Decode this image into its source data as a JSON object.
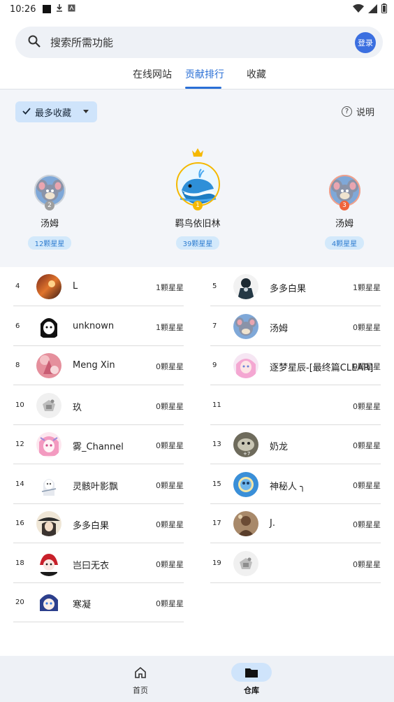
{
  "status": {
    "time": "10:26"
  },
  "search": {
    "placeholder": "搜索所需功能",
    "login": "登录"
  },
  "tabs": [
    {
      "label": "在线网站"
    },
    {
      "label": "贡献排行"
    },
    {
      "label": "收藏"
    }
  ],
  "filter": {
    "label": "最多收藏",
    "help": "说明"
  },
  "top3": [
    {
      "rank": "1",
      "name": "羁鸟依旧林",
      "stars": "39颗星星"
    },
    {
      "rank": "2",
      "name": "汤姆",
      "stars": "12颗星星"
    },
    {
      "rank": "3",
      "name": "汤姆",
      "stars": "4颗星星"
    }
  ],
  "rows": [
    {
      "rank": "4",
      "name": "L",
      "stars": "1颗星星",
      "avatar": "sunset"
    },
    {
      "rank": "5",
      "name": "多多白果",
      "stars": "1颗星星",
      "avatar": "dark-figure"
    },
    {
      "rank": "6",
      "name": "unknown",
      "stars": "1颗星星",
      "avatar": "anime-bw"
    },
    {
      "rank": "7",
      "name": "汤姆",
      "stars": "0颗星星",
      "avatar": "tom"
    },
    {
      "rank": "8",
      "name": "Meng Xin",
      "stars": "0颗星星",
      "avatar": "pink-fox"
    },
    {
      "rank": "9",
      "name": "逐梦星辰-[最终篇CLEAR]",
      "stars": "0颗星星",
      "avatar": "pink-girl"
    },
    {
      "rank": "10",
      "name": "玖",
      "stars": "0颗星星",
      "avatar": "default"
    },
    {
      "rank": "11",
      "name": "",
      "stars": "0颗星星",
      "avatar": "none"
    },
    {
      "rank": "12",
      "name": "雾_Channel",
      "stars": "0颗星星",
      "avatar": "pink-anime"
    },
    {
      "rank": "13",
      "name": "奶龙",
      "stars": "0颗星星",
      "avatar": "gray-photo"
    },
    {
      "rank": "14",
      "name": "灵骸叶影飘",
      "stars": "0颗星星",
      "avatar": "white-anime"
    },
    {
      "rank": "15",
      "name": "神秘人 ╮",
      "stars": "0颗星星",
      "avatar": "blue-planet"
    },
    {
      "rank": "16",
      "name": "多多白果",
      "stars": "0颗星星",
      "avatar": "hat-girl"
    },
    {
      "rank": "17",
      "name": "J.",
      "stars": "0颗星星",
      "avatar": "brown-photo"
    },
    {
      "rank": "18",
      "name": "岂曰无衣",
      "stars": "0颗星星",
      "avatar": "red-anime"
    },
    {
      "rank": "19",
      "name": "",
      "stars": "0颗星星",
      "avatar": "default"
    },
    {
      "rank": "20",
      "name": "寒凝",
      "stars": "0颗星星",
      "avatar": "blue-anime"
    }
  ],
  "nav": [
    {
      "label": "首页",
      "icon": "home-icon"
    },
    {
      "label": "仓库",
      "icon": "folder-icon"
    }
  ],
  "colors": {
    "accent": "#2a6fd6",
    "pill_bg": "#d3e9fb",
    "gold": "#f5b800",
    "silver": "#9e9e9e",
    "bronze": "#f0643c"
  }
}
